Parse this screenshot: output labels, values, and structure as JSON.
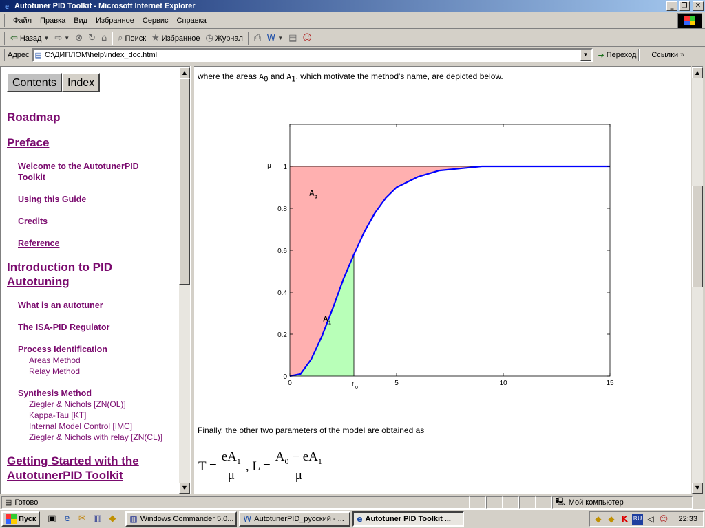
{
  "window": {
    "title": "Autotuner PID Toolkit - Microsoft Internet Explorer"
  },
  "menu": [
    "Файл",
    "Правка",
    "Вид",
    "Избранное",
    "Сервис",
    "Справка"
  ],
  "toolbar": {
    "back": "Назад",
    "search": "Поиск",
    "favorites": "Избранное",
    "history": "Журнал"
  },
  "address": {
    "label": "Адрес",
    "url": "C:\\ДИПЛОМ\\help\\index_doc.html",
    "go": "Переход",
    "links": "Ссылки"
  },
  "tabs": {
    "contents": "Contents",
    "index": "Index"
  },
  "toc": {
    "roadmap": "Roadmap",
    "preface": "Preface",
    "welcome": "Welcome to the AutotunerPID Toolkit",
    "using": "Using this Guide",
    "credits": "Credits",
    "reference": "Reference",
    "intro": "Introduction to PID Autotuning",
    "what": "What is an autotuner",
    "isa": "The ISA-PID Regulator",
    "process": "Process Identification",
    "areas": "Areas Method",
    "relay": "Relay Method",
    "synthesis": "Synthesis Method",
    "zn_ol": "Ziegler & Nichols [ZN(OL)]",
    "kt": "Kappa-Tau [KT]",
    "imc": "Internal Model Control [IMC]",
    "zn_cl": "Ziegler & Nichols with relay [ZN(CL)]",
    "getting": "Getting Started with the AutotunerPID Toolkit"
  },
  "content": {
    "intro_before": "where the areas ",
    "a0": "A",
    "a0_sub": "0",
    "and": " and ",
    "a1": "A",
    "a1_sub": "1",
    "intro_after": ", which motivate the method's name, are depicted below.",
    "finally": "Finally, the other two parameters of the model are obtained as"
  },
  "formula": {
    "t": "T =",
    "l": ", L =",
    "e_a1": "eA",
    "mu": "μ",
    "a0_minus": "A",
    "minus_e": " − eA"
  },
  "chart_data": {
    "type": "area",
    "x_ticks": [
      "0",
      "5",
      "10",
      "15"
    ],
    "y_ticks": [
      "0",
      "0.2",
      "0.4",
      "0.6",
      "0.8",
      "1"
    ],
    "xlim": [
      0,
      15
    ],
    "ylim": [
      0,
      1.2
    ],
    "ylabel": "μ",
    "t0_label": "t",
    "t0_sub": "0",
    "t0": 3,
    "mu": 1,
    "series": [
      {
        "x": [
          0,
          0.5,
          1,
          1.5,
          2,
          2.5,
          3,
          3.5,
          4,
          4.5,
          5,
          6,
          7,
          8,
          9,
          10,
          11,
          12,
          13,
          14,
          15
        ],
        "values": [
          0,
          0.01,
          0.08,
          0.19,
          0.32,
          0.46,
          0.58,
          0.69,
          0.78,
          0.85,
          0.9,
          0.95,
          0.98,
          0.99,
          1,
          1,
          1,
          1,
          1,
          1,
          1
        ]
      }
    ],
    "labels": {
      "a0": "A",
      "a0_sub": "0",
      "a1": "A",
      "a1_sub": "1"
    },
    "colors": {
      "curve": "#0000ff",
      "a0_fill": "#ffb0b0",
      "a1_fill": "#b8ffb8"
    }
  },
  "status": {
    "ready": "Готово",
    "zone": "Мой компьютер"
  },
  "taskbar": {
    "start": "Пуск",
    "tasks": [
      "Windows Commander 5.0...",
      "AutotunerPID_русский - ...",
      "Autotuner PID Toolkit ..."
    ],
    "clock": "22:33"
  }
}
